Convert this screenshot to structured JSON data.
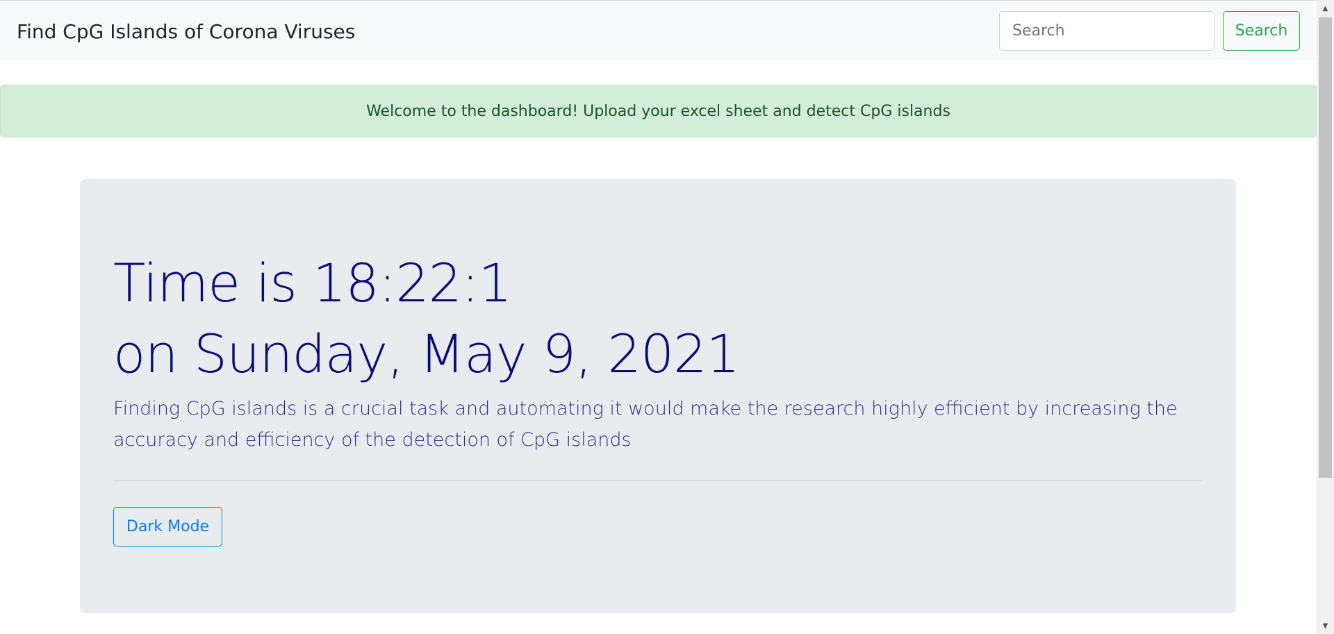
{
  "navbar": {
    "brand": "Find CpG Islands of Corona Viruses",
    "search_placeholder": "Search",
    "search_button": "Search"
  },
  "alert": {
    "message": "Welcome to the dashboard! Upload your excel sheet and detect CpG islands"
  },
  "jumbotron": {
    "time_text": "Time is 18:22:1",
    "date_text": "on Sunday, May 9, 2021",
    "lead": "Finding CpG islands is a crucial task and automating it would make the research highly efficient by increasing the accuracy and efficiency of the detection of CpG islands",
    "button_label": "Dark Mode"
  },
  "colors": {
    "navbar_bg": "#f8f9fa",
    "alert_bg": "#d4edda",
    "alert_text": "#155724",
    "jumbotron_bg": "#e9ecef",
    "heading_text": "#0b0b7a",
    "success": "#28a745",
    "primary": "#007bff"
  },
  "icons": {
    "scroll_up": "chevron-up-icon",
    "scroll_down": "chevron-down-icon"
  }
}
